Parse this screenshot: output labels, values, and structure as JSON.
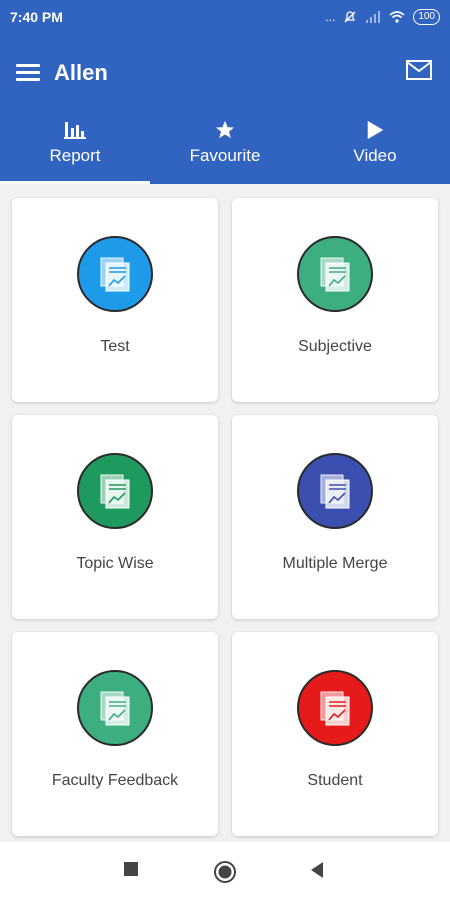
{
  "status": {
    "time": "7:40 PM",
    "signal": "...",
    "battery": "100"
  },
  "app": {
    "title": "Allen"
  },
  "tabs": [
    {
      "label": "Report",
      "icon": "bar-chart-icon",
      "selected": true
    },
    {
      "label": "Favourite",
      "icon": "star-icon",
      "selected": false
    },
    {
      "label": "Video",
      "icon": "play-icon",
      "selected": false
    }
  ],
  "cards": [
    {
      "label": "Test",
      "color": "#1e9be8"
    },
    {
      "label": "Subjective",
      "color": "#3cae80"
    },
    {
      "label": "Topic Wise",
      "color": "#1f9a5e"
    },
    {
      "label": "Multiple Merge",
      "color": "#3b4fb0"
    },
    {
      "label": "Faculty Feedback",
      "color": "#3cae80"
    },
    {
      "label": "Student",
      "color": "#e51b1b"
    }
  ],
  "theme": {
    "primary": "#3163c0"
  }
}
